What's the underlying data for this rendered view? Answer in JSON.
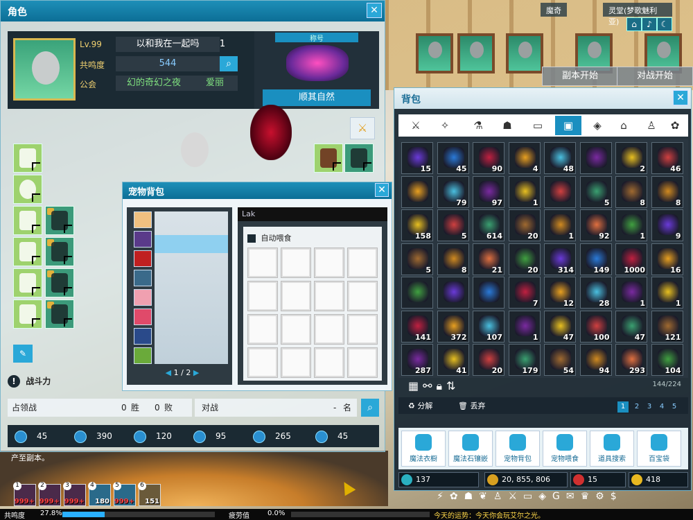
{
  "top": {
    "location_left": "魔奇",
    "location_right": "灵堂(梦歌魅利亚)",
    "btn_dungeon": "副本开始",
    "btn_battle": "对战开始"
  },
  "char": {
    "window_title": "角色",
    "level": "Lv.99",
    "name": "以和我在一起吗",
    "name_num": "1",
    "resonance_label": "共鸣度",
    "resonance_value": "544",
    "guild_label": "公会",
    "guild_name": "幻的奇幻之夜",
    "guild_member": "爱丽",
    "title_header": "称号",
    "title_name": "顺其自然",
    "power_label": "战斗力",
    "territory": {
      "label": "占领战",
      "wins": "0",
      "wins_unit": "胜",
      "losses": "0",
      "losses_unit": "败"
    },
    "duel": {
      "label": "对战",
      "rank": "-",
      "rank_unit": "名"
    },
    "stats": [
      {
        "icon": "flame-icon",
        "value": "45"
      },
      {
        "icon": "water-drop-icon",
        "value": "390"
      },
      {
        "icon": "leaf-icon",
        "value": "120"
      },
      {
        "icon": "wind-icon",
        "value": "95"
      },
      {
        "icon": "star-icon",
        "value": "265"
      },
      {
        "icon": "moon-icon",
        "value": "45"
      }
    ],
    "footnote": "产至副本。"
  },
  "pet": {
    "window_title": "宠物背包",
    "header": "Lak",
    "auto_feed": "自动喂食",
    "page": "1 / 2"
  },
  "bag": {
    "window_title": "背包",
    "counts": [
      [
        "15",
        "45",
        "90",
        "4",
        "48",
        "",
        "2",
        "46"
      ],
      [
        "",
        "79",
        "97",
        "1",
        "",
        "5",
        "8",
        "8"
      ],
      [
        "158",
        "5",
        "614",
        "20",
        "1",
        "92",
        "1",
        "9"
      ],
      [
        "5",
        "8",
        "21",
        "20",
        "314",
        "149",
        "1000",
        "16"
      ],
      [
        "",
        "",
        "",
        "7",
        "12",
        "28",
        "1",
        "1"
      ],
      [
        "141",
        "372",
        "107",
        "1",
        "47",
        "100",
        "47",
        "121"
      ],
      [
        "287",
        "41",
        "20",
        "179",
        "54",
        "94",
        "293",
        "104"
      ]
    ],
    "capacity": "144/224",
    "decompose": "分解",
    "discard": "丢弃",
    "pages": [
      "1",
      "2",
      "3",
      "4",
      "5"
    ],
    "functions": [
      "魔法衣橱",
      "魔法石镶嵌",
      "宠物背包",
      "宠物喂食",
      "道具搜索",
      "百宝袋"
    ],
    "currency": {
      "c1": "137",
      "gold": "20, 855, 806",
      "a": "15",
      "star": "418"
    }
  },
  "hud": {
    "slots": [
      "999+",
      "999+",
      "999+",
      "180",
      "999+",
      "151"
    ],
    "resonance_label": "共鸣度",
    "resonance_pct": "27.8%",
    "resonance_fraction": 0.278,
    "fatigue_label": "疲劳值",
    "fatigue_pct": "0.0%",
    "fortune": "今天的运势：今天你会玩艾尔之光。"
  },
  "colors": {
    "accent": "#1a8fc0",
    "title_bar": "#0c6e96"
  }
}
